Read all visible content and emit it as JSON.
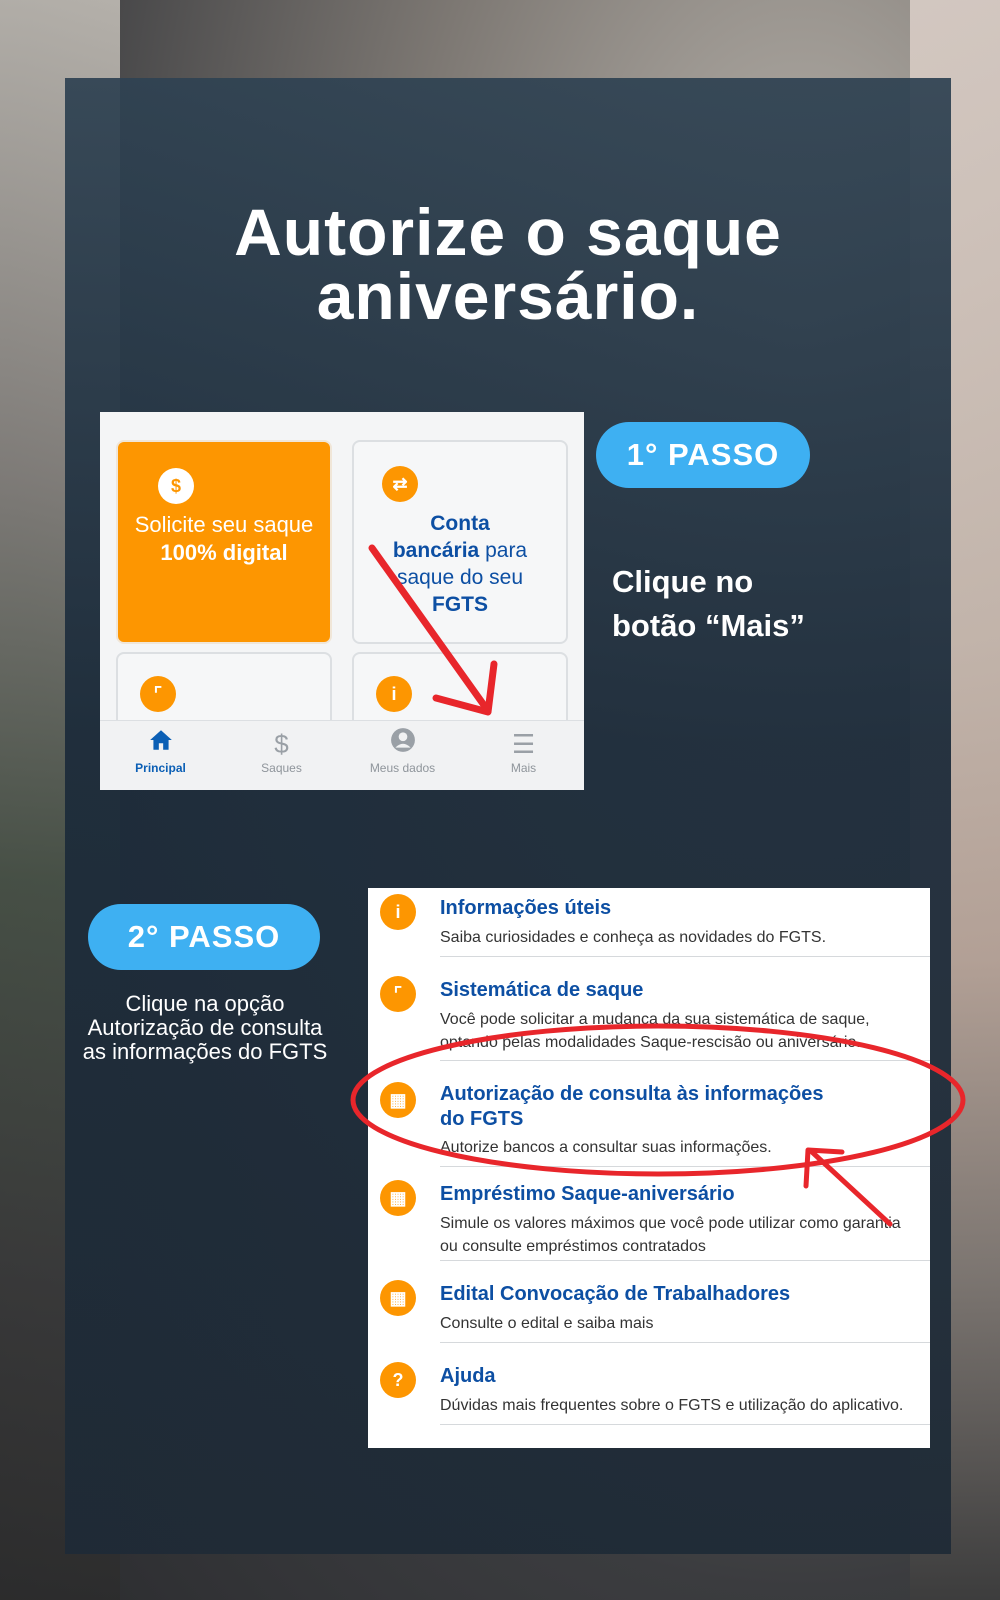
{
  "title": {
    "line1": "Autorize o saque",
    "line2": "aniversário."
  },
  "step1": {
    "pill": "1° PASSO",
    "instruction_line1": "Clique no",
    "instruction_line2": "botão “Mais”",
    "screenshot": {
      "card_orange": {
        "line1": "Solicite seu saque",
        "line2": "100% digital",
        "icon": "dollar-icon"
      },
      "card_conta": {
        "bold1": "Conta",
        "bold2": "bancária",
        "rest1": " para",
        "line3": "saque do seu",
        "bold3": "FGTS",
        "icon": "transfer-icon"
      },
      "tabs": [
        {
          "label": "Principal",
          "icon": "home-icon"
        },
        {
          "label": "Saques",
          "icon": "dollar-icon"
        },
        {
          "label": "Meus dados",
          "icon": "user-icon"
        },
        {
          "label": "Mais",
          "icon": "menu-icon"
        }
      ]
    }
  },
  "step2": {
    "pill": "2° PASSO",
    "instruction_line1": "Clique na opção",
    "instruction_line2": "Autorização de consulta",
    "instruction_line3": "as informações do FGTS",
    "menu": [
      {
        "title": "Informações úteis",
        "desc": "Saiba curiosidades e conheça as novidades do FGTS.",
        "icon": "info-icon"
      },
      {
        "title": "Sistemática de saque",
        "desc": "Você pode solicitar a mudança da sua sistemática de saque, optando pelas modalidades Saque-rescisão ou aniversário.",
        "icon": "flag-icon"
      },
      {
        "title": "Autorização de consulta às informações do FGTS",
        "desc": "Autorize bancos a consultar suas informações.",
        "icon": "bank-icon"
      },
      {
        "title": "Empréstimo Saque-aniversário",
        "desc": "Simule os valores máximos que você pode utilizar como garantia ou consulte empréstimos contratados",
        "icon": "calculator-icon"
      },
      {
        "title": "Edital Convocação de Trabalhadores",
        "desc": "Consulte o edital e saiba mais",
        "icon": "calculator-icon"
      },
      {
        "title": "Ajuda",
        "desc": "Dúvidas mais frequentes sobre o FGTS e utilização do aplicativo.",
        "icon": "question-icon"
      }
    ]
  },
  "colors": {
    "accent_blue": "#3eb0f2",
    "orange": "#fd9601",
    "app_blue": "#0d4fa3",
    "annotation_red": "#e8262b"
  }
}
